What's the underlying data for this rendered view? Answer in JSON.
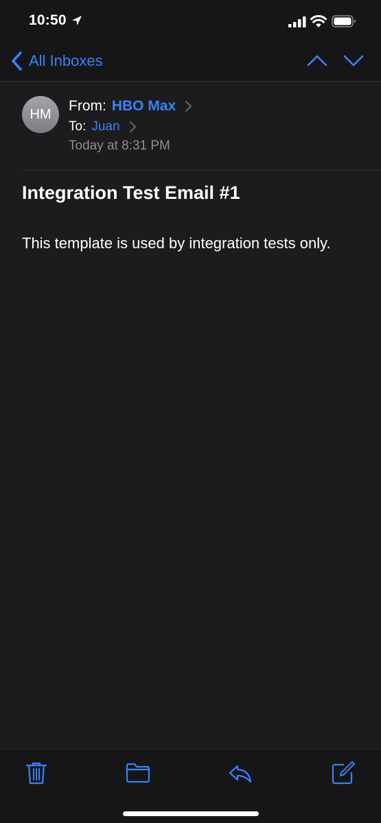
{
  "status_bar": {
    "time": "10:50",
    "icons": [
      "location-arrow-icon",
      "cellular-signal-icon",
      "wifi-icon",
      "battery-icon"
    ]
  },
  "nav": {
    "back_label": "All Inboxes",
    "prev_icon": "chevron-up-icon",
    "next_icon": "chevron-down-icon"
  },
  "email": {
    "avatar_initials": "HM",
    "from_label": "From:",
    "sender": "HBO Max",
    "to_label": "To:",
    "recipient": "Juan",
    "date": "Today at 8:31 PM",
    "subject": "Integration Test Email #1",
    "body": "This template is used by integration tests only."
  },
  "toolbar": {
    "items": [
      "trash-icon",
      "folder-icon",
      "reply-icon",
      "compose-icon"
    ]
  },
  "colors": {
    "accent": "#3a82f7",
    "background": "#1c1c1e",
    "secondary_text": "#8e8e93"
  }
}
